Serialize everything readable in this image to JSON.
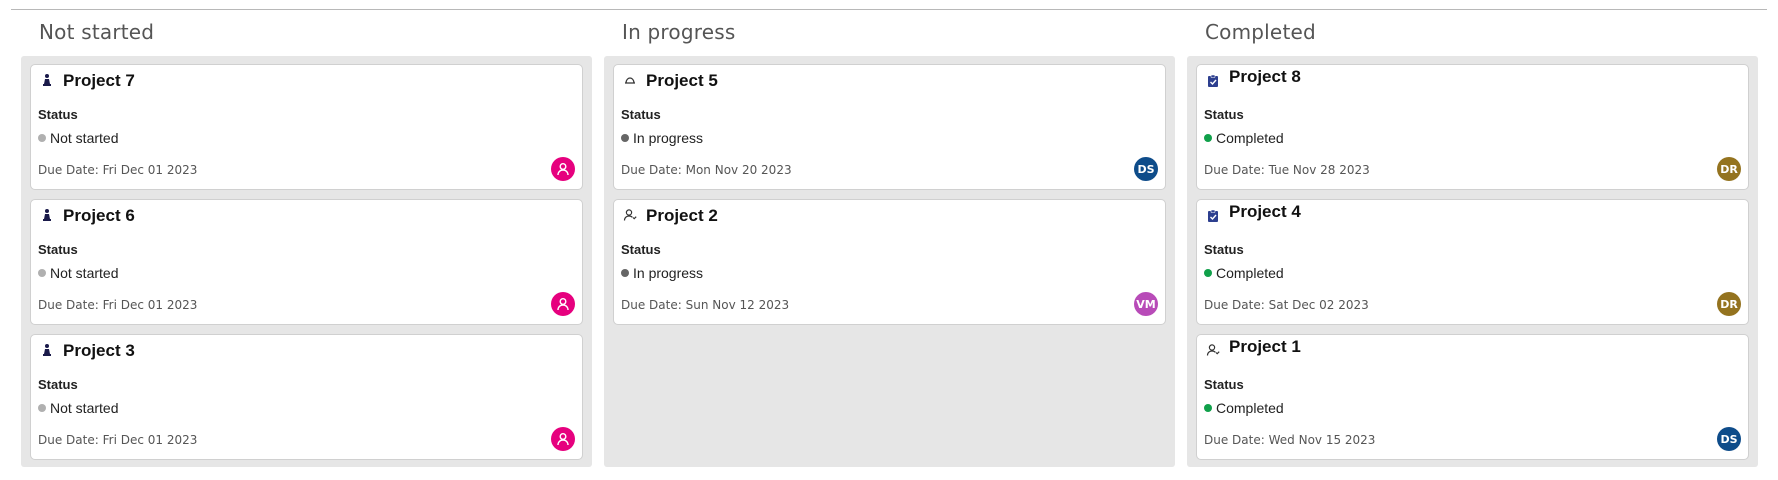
{
  "status_label": "Status",
  "due_prefix": "Due Date:",
  "columns": [
    {
      "title": "Not started",
      "cards": [
        {
          "title": "Project 7",
          "icon": "chess-pawn-icon",
          "status": "Not started",
          "status_color": "#b0b0b0",
          "due": "Fri Dec 01 2023",
          "avatar_icon": "user-icon",
          "avatar_initials": "",
          "avatar_color": "#e6007e"
        },
        {
          "title": "Project 6",
          "icon": "chess-pawn-icon",
          "status": "Not started",
          "status_color": "#b0b0b0",
          "due": "Fri Dec 01 2023",
          "avatar_icon": "user-icon",
          "avatar_initials": "",
          "avatar_color": "#e6007e"
        },
        {
          "title": "Project 3",
          "icon": "chess-pawn-icon",
          "status": "Not started",
          "status_color": "#b0b0b0",
          "due": "Fri Dec 01 2023",
          "avatar_icon": "user-icon",
          "avatar_initials": "",
          "avatar_color": "#e6007e"
        }
      ]
    },
    {
      "title": "In progress",
      "cards": [
        {
          "title": "Project 5",
          "icon": "cap-icon",
          "status": "In progress",
          "status_color": "#666666",
          "due": "Mon Nov 20 2023",
          "avatar_icon": "",
          "avatar_initials": "DS",
          "avatar_color": "#0e4c8a"
        },
        {
          "title": "Project 2",
          "icon": "person-outline-icon",
          "status": "In progress",
          "status_color": "#666666",
          "due": "Sun Nov 12 2023",
          "avatar_icon": "",
          "avatar_initials": "VM",
          "avatar_color": "#b84bb8"
        }
      ]
    },
    {
      "title": "Completed",
      "cards": [
        {
          "title": "Project 8",
          "icon": "clipboard-check-icon",
          "status": "Completed",
          "status_color": "#10a04a",
          "due": "Tue Nov 28 2023",
          "avatar_icon": "",
          "avatar_initials": "DR",
          "avatar_color": "#94731f"
        },
        {
          "title": "Project 4",
          "icon": "clipboard-check-icon",
          "status": "Completed",
          "status_color": "#10a04a",
          "due": "Sat Dec 02 2023",
          "avatar_icon": "",
          "avatar_initials": "DR",
          "avatar_color": "#94731f"
        },
        {
          "title": "Project 1",
          "icon": "person-outline-icon",
          "status": "Completed",
          "status_color": "#10a04a",
          "due": "Wed Nov 15 2023",
          "avatar_icon": "",
          "avatar_initials": "DS",
          "avatar_color": "#0e4c8a"
        }
      ]
    }
  ]
}
